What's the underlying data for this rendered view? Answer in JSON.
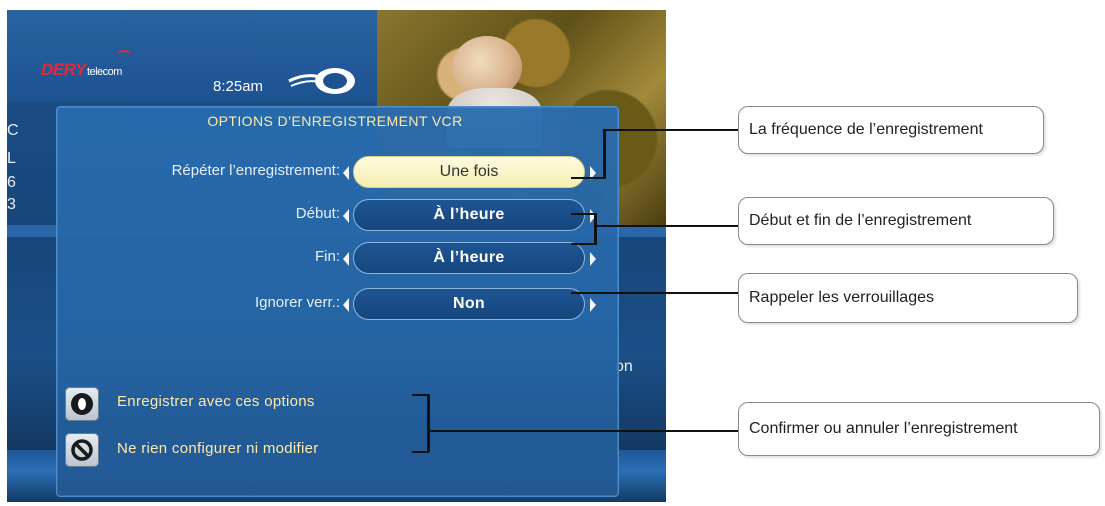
{
  "tv": {
    "brand": {
      "name_red": "DERY",
      "name_white": "telecom"
    },
    "clock": "8:25am",
    "side_fragments": [
      "C",
      "L",
      "6",
      "3",
      "on"
    ]
  },
  "dialog": {
    "title": "OPTIONS D’ENREGISTREMENT VCR",
    "rows": [
      {
        "label": "Répéter l’enregistrement:",
        "value": "Une fois",
        "selected": true
      },
      {
        "label": "Début:",
        "value": "À l’heure",
        "selected": false
      },
      {
        "label": "Fin:",
        "value": "À l’heure",
        "selected": false
      },
      {
        "label": "Ignorer verr.:",
        "value": "Non",
        "selected": false
      }
    ],
    "actions": [
      {
        "label": "Enregistrer avec ces options",
        "icon": "record-button-icon"
      },
      {
        "label": "Ne rien configurer ni modifier",
        "icon": "cancel-icon"
      }
    ]
  },
  "callouts": [
    "La fréquence de l’enregistrement",
    "Début et fin de l’enregistrement",
    "Rappeler les verrouillages",
    "Confirmer ou annuler l’enregistrement"
  ]
}
